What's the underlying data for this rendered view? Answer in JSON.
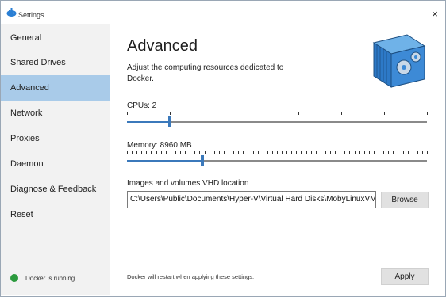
{
  "window": {
    "title": "Settings",
    "close_glyph": "×"
  },
  "sidebar": {
    "items": [
      {
        "label": "General",
        "active": false
      },
      {
        "label": "Shared Drives",
        "active": false
      },
      {
        "label": "Advanced",
        "active": true
      },
      {
        "label": "Network",
        "active": false
      },
      {
        "label": "Proxies",
        "active": false
      },
      {
        "label": "Daemon",
        "active": false
      },
      {
        "label": "Diagnose & Feedback",
        "active": false
      },
      {
        "label": "Reset",
        "active": false
      }
    ],
    "status": {
      "text": "Docker is running",
      "color": "#2b9a3e"
    }
  },
  "main": {
    "title": "Advanced",
    "description": "Adjust the computing resources dedicated to Docker.",
    "cpus": {
      "label": "CPUs: 2",
      "value": 2,
      "min": 1,
      "max": 8
    },
    "memory": {
      "label": "Memory: 8960 MB",
      "value": 8960,
      "min": 1024,
      "max": 32768
    },
    "vhd": {
      "label": "Images and volumes VHD location",
      "value": "C:\\Users\\Public\\Documents\\Hyper-V\\Virtual Hard Disks\\MobyLinuxVM.vhdx"
    },
    "browse_label": "Browse",
    "footer_note": "Docker will restart when applying these settings.",
    "apply_label": "Apply"
  },
  "colors": {
    "accent": "#3b79bb",
    "sidebar_active": "#a9cbe9",
    "sidebar_bg": "#f2f2f2"
  },
  "icons": {
    "title_icon": "docker-whale-icon",
    "hero": "docker-container-gears-icon"
  }
}
